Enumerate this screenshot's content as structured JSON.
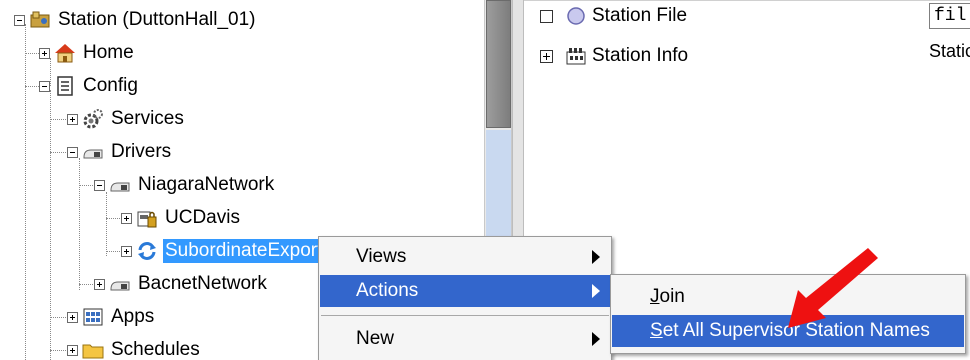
{
  "tree": {
    "items": [
      {
        "label": "Station (DuttonHall_01)",
        "icon": "station-icon"
      },
      {
        "label": "Home",
        "icon": "home-icon"
      },
      {
        "label": "Config",
        "icon": "config-icon"
      },
      {
        "label": "Services",
        "icon": "services-gear-icon"
      },
      {
        "label": "Drivers",
        "icon": "drivers-icon"
      },
      {
        "label": "NiagaraNetwork",
        "icon": "network-icon"
      },
      {
        "label": "UCDavis",
        "icon": "device-icon"
      },
      {
        "label": "SubordinateExportTagsNetworkExt",
        "icon": "sync-icon"
      },
      {
        "label": "BacnetNetwork",
        "icon": "network-icon"
      },
      {
        "label": "Apps",
        "icon": "apps-icon"
      },
      {
        "label": "Schedules",
        "icon": "folder-icon"
      }
    ]
  },
  "properties": {
    "rows": [
      {
        "label": "Station File",
        "value": "fil"
      },
      {
        "label": "Station Info",
        "value": "Static"
      }
    ]
  },
  "context_menu": {
    "items": [
      {
        "label": "Views"
      },
      {
        "label": "Actions"
      },
      {
        "label": "New"
      }
    ]
  },
  "actions_submenu": {
    "items": [
      {
        "label": "Join",
        "mnemonic": "J",
        "rest": "oin"
      },
      {
        "label": "Set All Supervisor Station Names",
        "mnemonic": "S",
        "rest": "et All Supervisor Station Names"
      }
    ]
  },
  "colors": {
    "selection": "#3399ff",
    "menu_highlight": "#3366cc",
    "annotation_arrow": "#ee1111"
  }
}
